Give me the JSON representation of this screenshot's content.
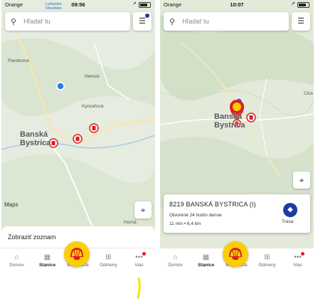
{
  "left": {
    "status": {
      "carrier": "Orange",
      "time": "09:56",
      "back_app": "Lyžiarske Stredisko"
    },
    "search": {
      "placeholder": "Hľadať tu"
    },
    "map_labels": {
      "city": "Banská Bystrica",
      "place1": "Nemce",
      "place2": "Kynceľová",
      "place3": "Pavelcova",
      "place4": "Horná",
      "attribution": "Maps"
    },
    "sheet": {
      "label": "Zobraziť zoznam"
    }
  },
  "right": {
    "status": {
      "carrier": "Orange",
      "time": "10:07"
    },
    "search": {
      "placeholder": "Hľadať tu"
    },
    "map_labels": {
      "city": "Banská Bystrica",
      "place1": "Clos"
    },
    "station": {
      "name": "8219 BANSKÁ BYSTRICA (I)",
      "hours": "Otvorené 24 hodín denne",
      "distance": "11 min • 6,4 km",
      "route_label": "Trasa"
    }
  },
  "nav": {
    "items": [
      {
        "label": "Domov",
        "icon": "home-icon"
      },
      {
        "label": "Stanice",
        "icon": "map-icon"
      },
      {
        "label": "Moja karta",
        "icon": "shell-logo"
      },
      {
        "label": "Odmeny",
        "icon": "gift-icon"
      },
      {
        "label": "Viac",
        "icon": "more-icon"
      }
    ]
  },
  "colors": {
    "shell_yellow": "#fbce07",
    "shell_red": "#dd1d21",
    "accent_blue": "#1a3e9e",
    "map_green": "#e9efe2"
  }
}
